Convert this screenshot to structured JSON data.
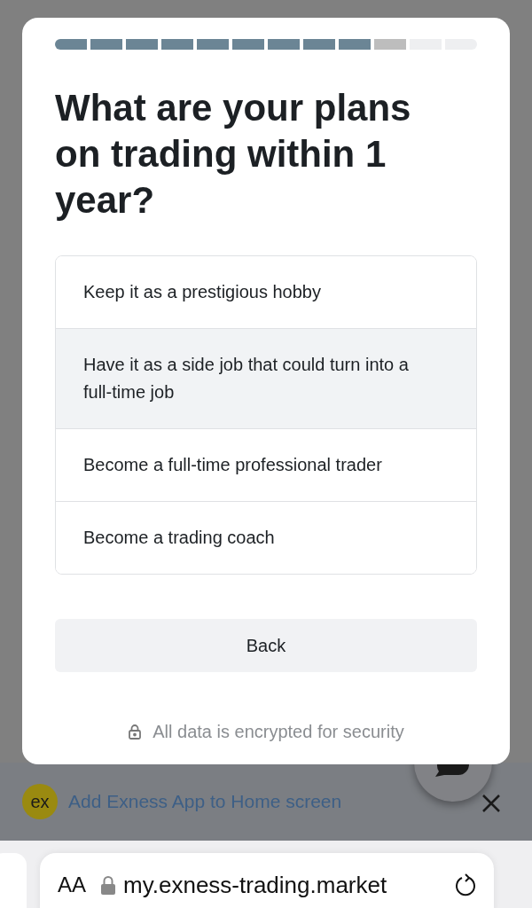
{
  "progress": [
    {
      "kind": "done"
    },
    {
      "kind": "done"
    },
    {
      "kind": "done"
    },
    {
      "kind": "done"
    },
    {
      "kind": "done"
    },
    {
      "kind": "done"
    },
    {
      "kind": "done"
    },
    {
      "kind": "done"
    },
    {
      "kind": "done"
    },
    {
      "kind": "current"
    },
    {
      "kind": "todo"
    },
    {
      "kind": "todo"
    }
  ],
  "question": "What are your plans on trading within 1 year?",
  "options": [
    {
      "label": "Keep it as a prestigious hobby",
      "selected": false
    },
    {
      "label": "Have it as a side job that could turn into a full-time job",
      "selected": true
    },
    {
      "label": "Become a full-time professional trader",
      "selected": false
    },
    {
      "label": "Become a trading coach",
      "selected": false
    }
  ],
  "back_button": "Back",
  "security_note": "All data is encrypted for security",
  "banner": {
    "logo": "ex",
    "text": "Add Exness App to Home screen"
  },
  "browser": {
    "text_size": "AA",
    "url": "my.exness-trading.market"
  }
}
